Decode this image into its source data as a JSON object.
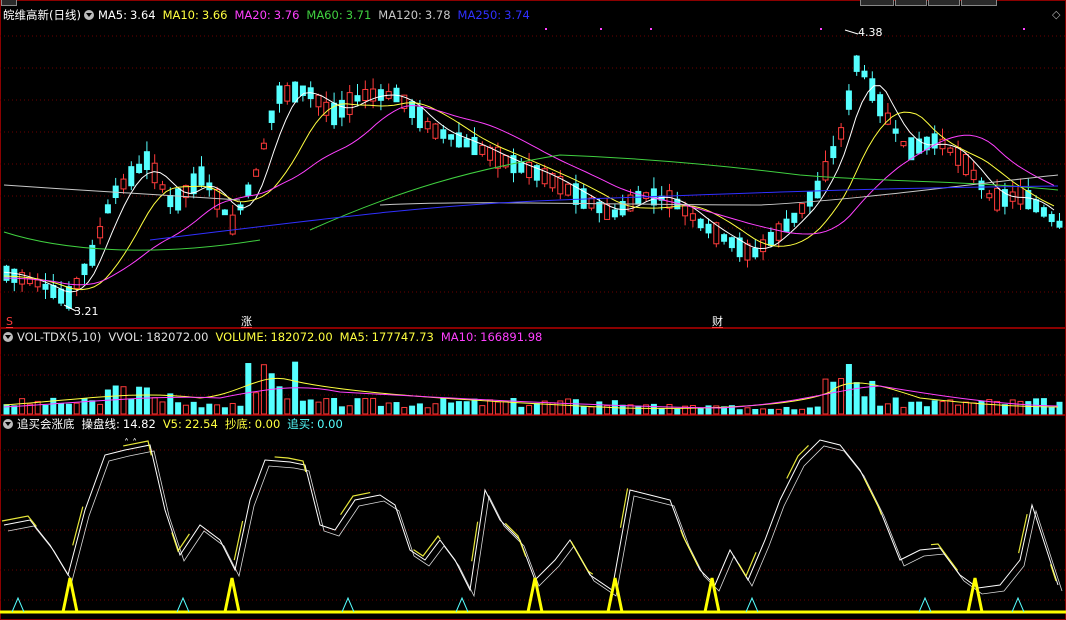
{
  "colors": {
    "up": "#ff3b3b",
    "down": "#55ffff",
    "bg": "#000000",
    "grid": "#6b0000",
    "ma5": "#ffffff",
    "ma10": "#ffff40",
    "ma20": "#ff40ff",
    "ma60": "#40d040",
    "ma120": "#c8c8c8",
    "ma250": "#3030ff",
    "kdj_white": "#ffffff",
    "kdj_yellow": "#ffff40",
    "buy_signal": "#ffff00",
    "cyan_signal": "#55ffff"
  },
  "main": {
    "title": "皖维高新(日线)",
    "ma": [
      {
        "label": "MA5:",
        "value": "3.64",
        "color": "#ffffff"
      },
      {
        "label": "MA10:",
        "value": "3.66",
        "color": "#ffff40"
      },
      {
        "label": "MA20:",
        "value": "3.76",
        "color": "#ff40ff"
      },
      {
        "label": "MA60:",
        "value": "3.71",
        "color": "#40d040"
      },
      {
        "label": "MA120:",
        "value": "3.78",
        "color": "#c8c8c8"
      },
      {
        "label": "MA250:",
        "value": "3.74",
        "color": "#3030ff"
      }
    ],
    "high_label": "4.38",
    "low_label": "3.21",
    "markers": [
      "S",
      "涨",
      "财"
    ],
    "diamond": "◇"
  },
  "volume": {
    "name": "VOL-TDX(5,10)",
    "items": [
      {
        "label": "VVOL:",
        "value": "182072.00",
        "color": "#e0e0e0"
      },
      {
        "label": "VOLUME:",
        "value": "182072.00",
        "color": "#ffff40"
      },
      {
        "label": "MA5:",
        "value": "177747.73",
        "color": "#ffff40"
      },
      {
        "label": "MA10:",
        "value": "166891.98",
        "color": "#ff40ff"
      }
    ]
  },
  "indicator": {
    "name": "追买会涨底",
    "items": [
      {
        "label": "操盘线:",
        "value": "14.82",
        "color": "#ffffff"
      },
      {
        "label": "V5:",
        "value": "22.54",
        "color": "#ffff40"
      },
      {
        "label": "抄底:",
        "value": "0.00",
        "color": "#ffff40"
      },
      {
        "label": "追买:",
        "value": "0.00",
        "color": "#55ffff"
      }
    ]
  }
}
